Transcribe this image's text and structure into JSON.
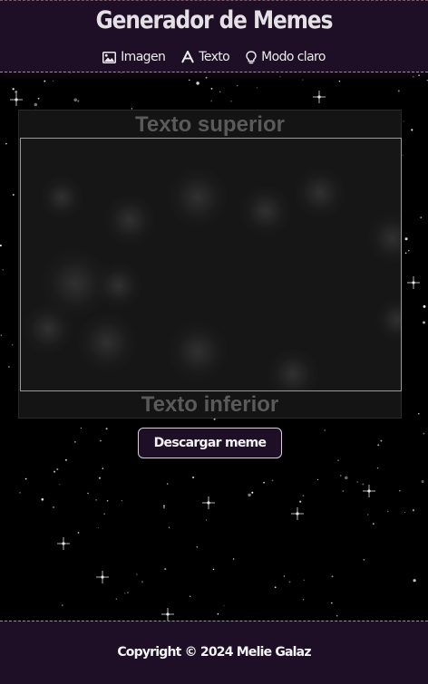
{
  "header": {
    "title": "Generador de Memes",
    "nav": [
      {
        "label": "Imagen",
        "icon": "image-icon"
      },
      {
        "label": "Texto",
        "icon": "text-icon"
      },
      {
        "label": "Modo claro",
        "icon": "lightbulb-icon"
      }
    ]
  },
  "meme": {
    "top_text": "Texto superior",
    "bottom_text": "Texto inferior"
  },
  "actions": {
    "download_label": "Descargar meme"
  },
  "footer": {
    "copyright": "Copyright © 2024 Melie Galaz"
  },
  "colors": {
    "header_bg": "#1e0f26",
    "page_bg": "#000000",
    "placeholder_text": "#5a5a5a"
  }
}
